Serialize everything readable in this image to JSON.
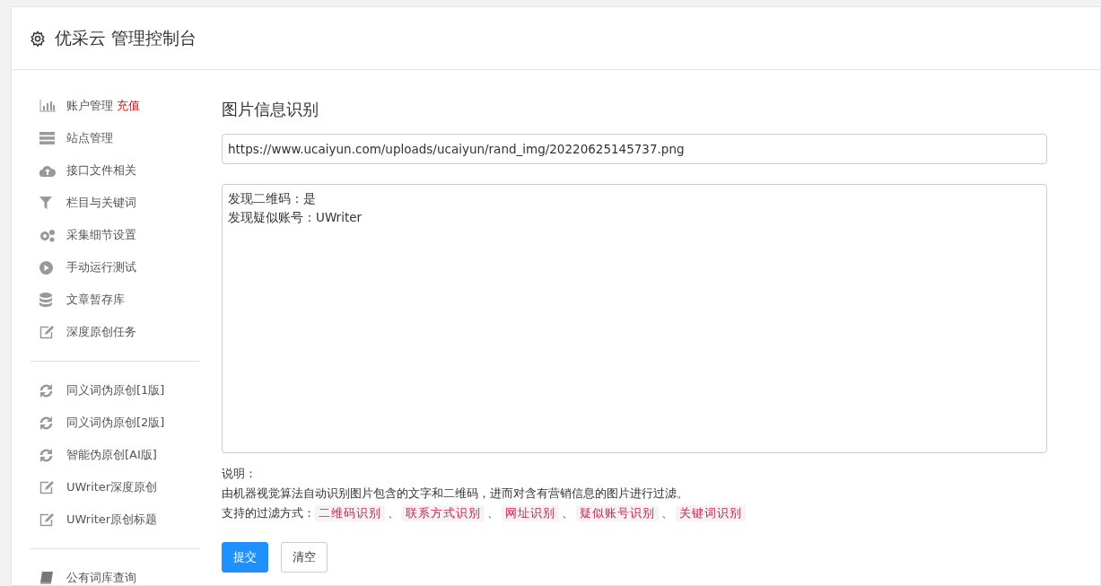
{
  "header": {
    "title": "优采云 管理控制台"
  },
  "sidebar": {
    "groups": [
      [
        {
          "label": "账户管理",
          "badge": "充值"
        },
        {
          "label": "站点管理"
        },
        {
          "label": "接口文件相关"
        },
        {
          "label": "栏目与关键词"
        },
        {
          "label": "采集细节设置"
        },
        {
          "label": "手动运行测试"
        },
        {
          "label": "文章暂存库"
        },
        {
          "label": "深度原创任务"
        }
      ],
      [
        {
          "label": "同义词伪原创[1版]"
        },
        {
          "label": "同义词伪原创[2版]"
        },
        {
          "label": "智能伪原创[AI版]"
        },
        {
          "label": "UWriter深度原创"
        },
        {
          "label": "UWriter原创标题"
        }
      ],
      [
        {
          "label": "公有词库查询"
        }
      ]
    ]
  },
  "main": {
    "title": "图片信息识别",
    "url_field": {
      "value": "https://www.ucaiyun.com/uploads/ucaiyun/rand_img/20220625145737.png"
    },
    "result_box": {
      "lines": [
        "发现二维码：是",
        "发现疑似账号：UWriter"
      ]
    },
    "notes": {
      "heading": "说明：",
      "description": "由机器视觉算法自动识别图片包含的文字和二维码，进而对含有营销信息的图片进行过滤。",
      "filter_label": "支持的过滤方式：",
      "tags": [
        {
          "text": "二维码识别",
          "separator": "、"
        },
        {
          "text": "联系方式识别",
          "separator": "、"
        },
        {
          "text": "网址识别",
          "separator": "、"
        },
        {
          "text": "疑似账号识别",
          "separator": "、"
        },
        {
          "text": "关键词识别"
        }
      ]
    },
    "buttons": [
      {
        "label": "提交",
        "kind": "primary"
      },
      {
        "label": "清空",
        "kind": "default"
      }
    ]
  }
}
